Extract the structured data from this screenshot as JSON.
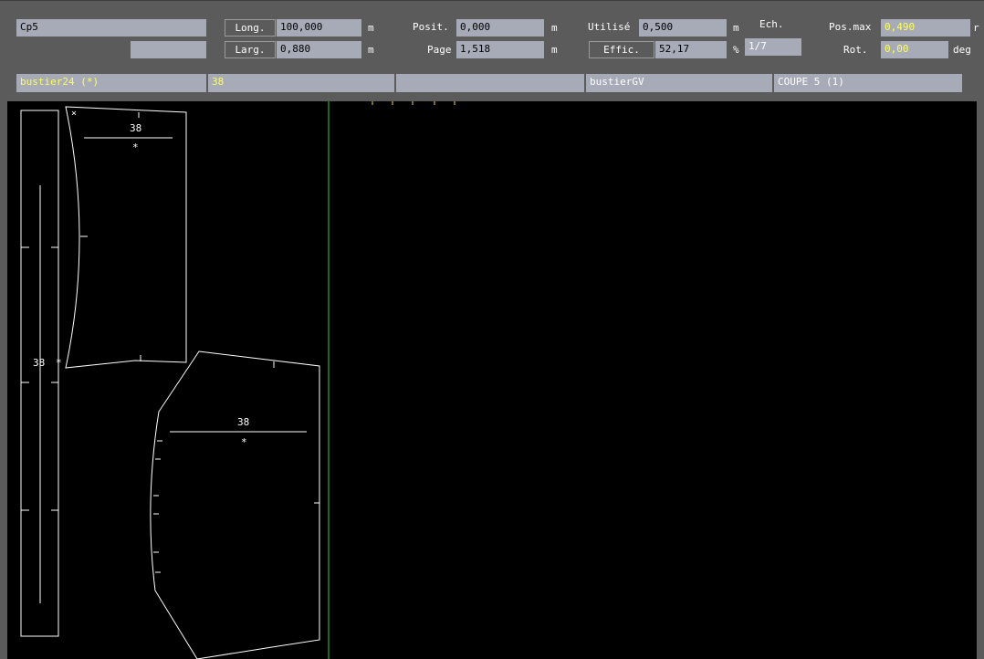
{
  "header": {
    "code": "Cp5",
    "code2": "",
    "long_label": "Long.",
    "long_value": "100,000",
    "long_unit": "m",
    "larg_label": "Larg.",
    "larg_value": "0,880",
    "larg_unit": "m",
    "posit_label": "Posit.",
    "posit_value": "0,000",
    "posit_unit": "m",
    "page_label": "Page",
    "page_value": "1,518",
    "page_unit": "m",
    "utilise_label": "Utilisé",
    "utilise_value": "0,500",
    "utilise_unit": "m",
    "effic_label": "Effic.",
    "effic_value": "52,17",
    "effic_unit": "%",
    "ech_label": "Ech.",
    "ech_value": "1/7",
    "posmax_label": "Pos.max",
    "posmax_value": "0,490",
    "posmax_unit": "r",
    "rot_label": "Rot.",
    "rot_value": "0,00",
    "rot_unit": "deg"
  },
  "infobar": {
    "model": "bustier24 (*)",
    "size": "38",
    "empty": "",
    "variant": "bustierGV",
    "cut": "COUPE 5 (1)"
  },
  "canvas": {
    "piece1_size": "38",
    "piece1_mark": "*",
    "piece2_size": "38",
    "piece2_mark": "*",
    "strip_size": "38",
    "strip_mark": "*",
    "corner_mark": "×"
  },
  "colors": {
    "panel_bg": "#5b5b5b",
    "field_bg": "#a7abb8",
    "highlight_text": "#ffff55",
    "canvas_bg": "#000000",
    "piece_stroke": "#ffffff",
    "limit_line": "#33cc33"
  }
}
